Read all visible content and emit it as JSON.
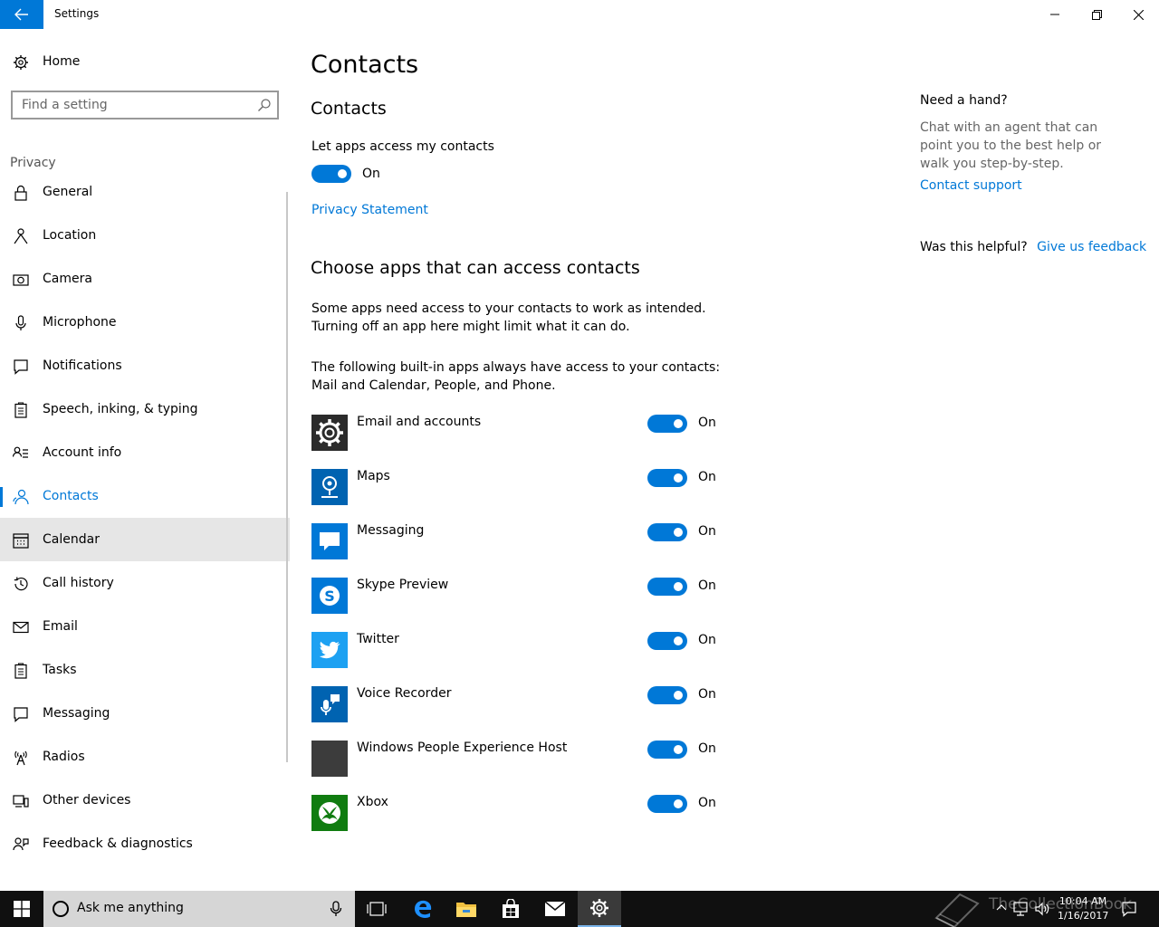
{
  "window": {
    "title": "Settings",
    "back_icon": "back-arrow-icon",
    "controls": [
      "minimize-icon",
      "restore-icon",
      "close-icon"
    ]
  },
  "sidebar": {
    "home_label": "Home",
    "search_placeholder": "Find a setting",
    "section_label": "Privacy",
    "items": [
      {
        "label": "General",
        "icon": "lock-icon"
      },
      {
        "label": "Location",
        "icon": "location-person-icon"
      },
      {
        "label": "Camera",
        "icon": "camera-icon"
      },
      {
        "label": "Microphone",
        "icon": "microphone-icon"
      },
      {
        "label": "Notifications",
        "icon": "notification-icon"
      },
      {
        "label": "Speech, inking, & typing",
        "icon": "clipboard-icon"
      },
      {
        "label": "Account info",
        "icon": "account-info-icon"
      },
      {
        "label": "Contacts",
        "icon": "contacts-icon"
      },
      {
        "label": "Calendar",
        "icon": "calendar-icon"
      },
      {
        "label": "Call history",
        "icon": "history-icon"
      },
      {
        "label": "Email",
        "icon": "mail-icon"
      },
      {
        "label": "Tasks",
        "icon": "tasks-icon"
      },
      {
        "label": "Messaging",
        "icon": "message-icon"
      },
      {
        "label": "Radios",
        "icon": "radio-tower-icon"
      },
      {
        "label": "Other devices",
        "icon": "devices-icon"
      },
      {
        "label": "Feedback & diagnostics",
        "icon": "feedback-icon"
      }
    ],
    "active_item": "Contacts",
    "hovered_item": "Calendar"
  },
  "main": {
    "title": "Contacts",
    "subtitle": "Contacts",
    "access_label": "Let apps access my contacts",
    "access_state": "On",
    "privacy_link": "Privacy Statement",
    "choose_heading": "Choose apps that can access contacts",
    "para1": "Some apps need access to your contacts to work as intended. Turning off an app here might limit what it can do.",
    "para2": "The following built-in apps always have access to your contacts: Mail and Calendar, People, and Phone.",
    "apps": [
      {
        "name": "Email and accounts",
        "state": "On",
        "tile_color": "#2b2b2b",
        "icon": "gear-icon"
      },
      {
        "name": "Maps",
        "state": "On",
        "tile_color": "#0063b1",
        "icon": "maps-pin-icon"
      },
      {
        "name": "Messaging",
        "state": "On",
        "tile_color": "#0078d7",
        "icon": "chat-bubble-icon"
      },
      {
        "name": "Skype Preview",
        "state": "On",
        "tile_color": "#0078d7",
        "icon": "skype-icon"
      },
      {
        "name": "Twitter",
        "state": "On",
        "tile_color": "#1da1f2",
        "icon": "twitter-bird-icon"
      },
      {
        "name": "Voice Recorder",
        "state": "On",
        "tile_color": "#0063b1",
        "icon": "voice-recorder-icon"
      },
      {
        "name": "Windows People Experience Host",
        "state": "On",
        "tile_color": "#3c3c3c",
        "icon": "blank-tile-icon"
      },
      {
        "name": "Xbox",
        "state": "On",
        "tile_color": "#107c10",
        "icon": "xbox-icon"
      }
    ]
  },
  "help": {
    "heading": "Need a hand?",
    "text": "Chat with an agent that can point you to the best help or walk you step-by-step.",
    "support_link": "Contact support",
    "helpful_q": "Was this helpful?",
    "feedback_link": "Give us feedback"
  },
  "taskbar": {
    "search_text": "Ask me anything",
    "clock_time": "10:04 AM",
    "clock_date": "1/16/2017",
    "watermark": "TheCollectionBook"
  },
  "colors": {
    "accent": "#0078d7",
    "hover": "#e6e6e6",
    "taskbar": "#101010"
  }
}
